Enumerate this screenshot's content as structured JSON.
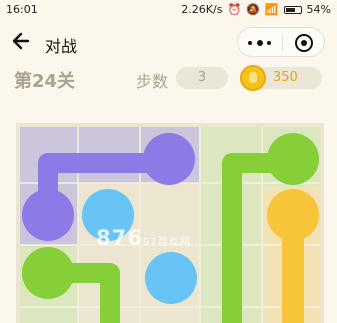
{
  "status_bar": {
    "time": "16:01",
    "net_speed": "2.26K/s",
    "battery": "54%"
  },
  "title_bar": {
    "title": "对战"
  },
  "info_bar": {
    "level": "第24关",
    "steps_label": "步数",
    "steps_value": "3",
    "coins": "350"
  },
  "watermark": {
    "big": "876",
    "small": "97游戏网"
  },
  "colors": {
    "background": "#fbf7ec",
    "purple": "#8c7ae6",
    "blue": "#68c4f5",
    "green": "#86cf38",
    "yellow": "#f8c43a"
  }
}
